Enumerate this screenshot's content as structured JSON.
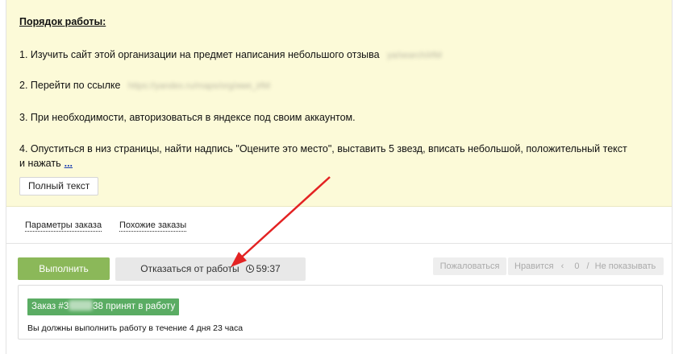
{
  "instructions": {
    "title": "Порядок работы:",
    "step1": "1. Изучить сайт этой организации на предмет написания небольшого отзыва",
    "step1_hidden": "ya/search/ИМ",
    "step2": "2. Перейти по ссылке",
    "step2_hidden": "https://yandex.ru/maps/org/имя_ИМ",
    "step3": "3. При необходимости, авторизоваться в яндексе под своим аккаунтом.",
    "step4_line1": "4. Опуститься в низ страницы, найти надпись \"Оцените это место\", выставить 5 звезд, вписать небольшой, положительный текст",
    "step4_line2": "и нажать",
    "more_link": "...",
    "full_text_button": "Полный текст"
  },
  "tabs": {
    "order_params": "Параметры заказа",
    "similar_orders": "Похожие заказы"
  },
  "actions": {
    "execute": "Выполнить",
    "refuse": "Отказаться от работы",
    "timer": "59:37",
    "complain": "Пожаловаться",
    "like": "Нравится",
    "like_count": "0",
    "like_sep": "‹",
    "slash": "/",
    "hide": "Не показывать"
  },
  "status": {
    "badge_prefix": "Заказ #3",
    "badge_suffix": "38 принят в работу",
    "badge_color": "#5aac63",
    "text": "Вы должны выполнить работу в течение 4 дня 23 часа"
  },
  "colors": {
    "instructions_bg": "#fcfad8",
    "primary_button": "#8bb859",
    "arrow": "#e32222"
  }
}
